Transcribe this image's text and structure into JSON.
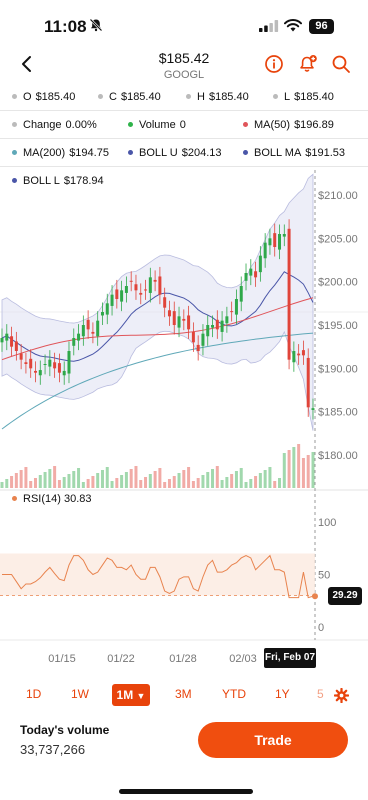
{
  "status": {
    "time": "11:08",
    "battery": "96"
  },
  "header": {
    "price": "$185.42",
    "ticker": "GOOGL"
  },
  "stats": {
    "row1": [
      {
        "label": "O",
        "value": "$185.40",
        "color": "#bbbbbb"
      },
      {
        "label": "C",
        "value": "$185.40",
        "color": "#bbbbbb"
      },
      {
        "label": "H",
        "value": "$185.40",
        "color": "#bbbbbb"
      },
      {
        "label": "L",
        "value": "$185.40",
        "color": "#bbbbbb"
      }
    ],
    "row2": [
      {
        "label": "Change",
        "value": "0.00%",
        "color": "#bbbbbb"
      },
      {
        "label": "Volume",
        "value": "0",
        "color": "#2fb34a"
      },
      {
        "label": "MA(50)",
        "value": "$196.89",
        "color": "#e0555a"
      }
    ],
    "row3": [
      {
        "label": "MA(200)",
        "value": "$194.75",
        "color": "#5fa8b8"
      },
      {
        "label": "BOLL U",
        "value": "$204.13",
        "color": "#4a56a8"
      },
      {
        "label": "BOLL MA",
        "value": "$191.53",
        "color": "#4a56a8"
      }
    ],
    "row4": [
      {
        "label": "BOLL L",
        "value": "$178.94",
        "color": "#4a56a8"
      }
    ]
  },
  "chart_data": {
    "type": "candlestick",
    "price_axis": [
      "$210.00",
      "$205.00",
      "$200.00",
      "$195.00",
      "$190.00",
      "$185.00",
      "$180.00"
    ],
    "x_ticks": [
      "01/15",
      "01/22",
      "01/28",
      "02/03"
    ],
    "cursor_date": "Fri, Feb 07",
    "closes": [
      193.5,
      194.0,
      192.5,
      192.0,
      191.0,
      190.5,
      190.0,
      189.5,
      189.8,
      190.5,
      191.0,
      190.0,
      189.5,
      189.7,
      192.0,
      193.5,
      194.0,
      195.0,
      194.5,
      194.0,
      195.5,
      196.5,
      197.5,
      198.5,
      198.0,
      199.0,
      199.5,
      200.0,
      199.0,
      198.5,
      199.0,
      200.5,
      200.0,
      198.5,
      197.0,
      196.0,
      195.0,
      196.0,
      195.5,
      194.5,
      193.0,
      192.0,
      194.0,
      195.0,
      195.0,
      194.5,
      195.5,
      196.0,
      196.5,
      198.0,
      199.5,
      201.0,
      201.5,
      200.5,
      203.0,
      204.5,
      205.0,
      204.0,
      205.5,
      205.5,
      191.0,
      192.0,
      191.5,
      191.5,
      185.5,
      185.4
    ],
    "rsi": {
      "label": "RSI(14)",
      "value": "30.83",
      "current": "29.29",
      "axis": [
        "100",
        "50",
        "0"
      ]
    }
  },
  "ranges": [
    "1D",
    "1W",
    "1M",
    "3M",
    "YTD",
    "1Y",
    "5"
  ],
  "active_range": "1M",
  "footer": {
    "volume_title": "Today's volume",
    "volume_value": "33,737,266",
    "trade": "Trade"
  }
}
